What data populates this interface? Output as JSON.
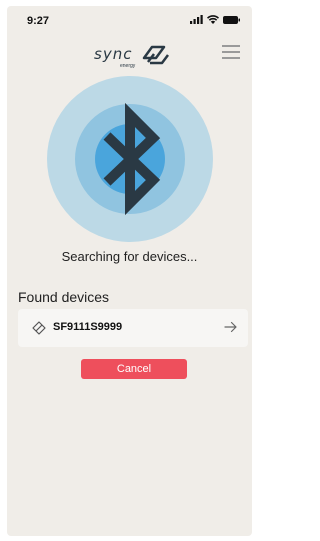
{
  "status_bar": {
    "time": "9:27"
  },
  "header": {
    "logo_text": "sync",
    "logo_subtext": "energy"
  },
  "search": {
    "status_text": "Searching for devices..."
  },
  "devices": {
    "title": "Found devices",
    "items": [
      {
        "name": "SF9111S9999"
      }
    ]
  },
  "actions": {
    "cancel_label": "Cancel"
  },
  "colors": {
    "background": "#f0ede8",
    "bluetooth_outer": "#bcd9e6",
    "bluetooth_mid": "#90c4e0",
    "bluetooth_inner": "#4aa5dc",
    "bluetooth_symbol": "#2a3944",
    "cancel_button": "#ee4f5c"
  },
  "icons": {
    "signal": "cellular-signal-icon",
    "wifi": "wifi-icon",
    "battery": "battery-icon",
    "menu": "hamburger-menu-icon",
    "bluetooth": "bluetooth-icon",
    "device": "device-tag-icon",
    "arrow": "arrow-right-icon"
  }
}
